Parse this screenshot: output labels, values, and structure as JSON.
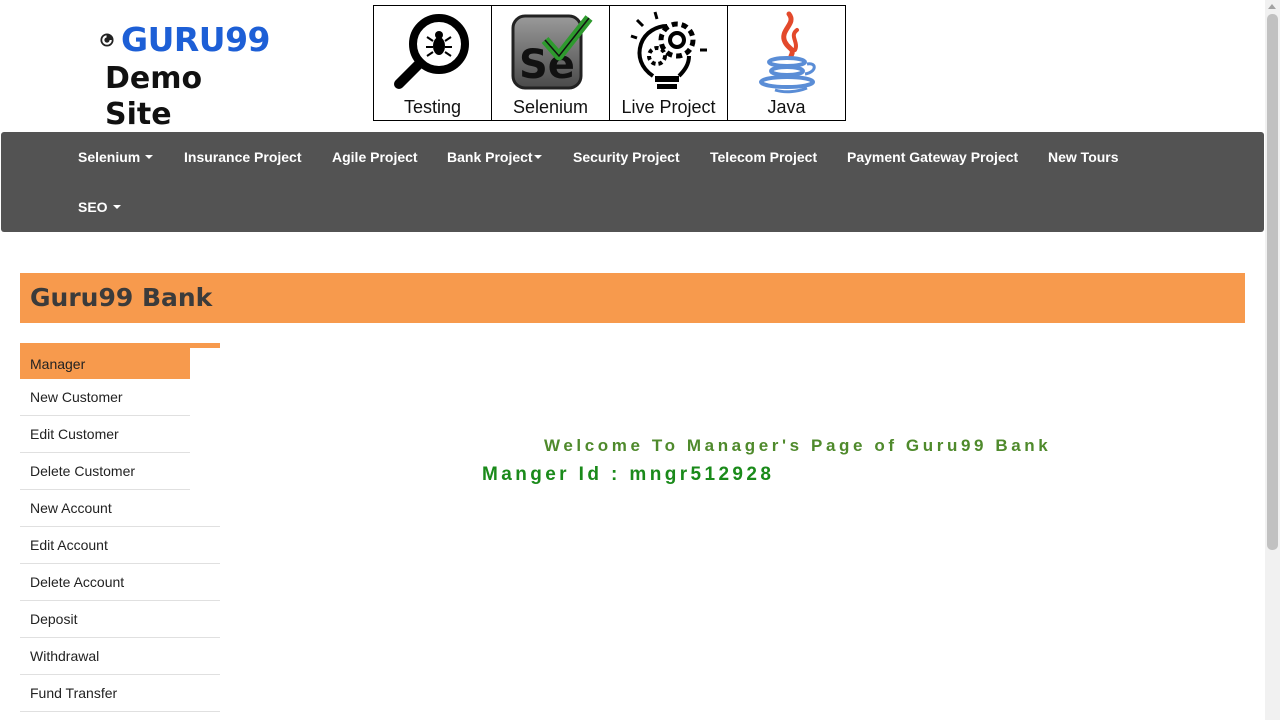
{
  "header": {
    "logo_text": "GURU99",
    "logo_sub": "Demo Site",
    "tiles": [
      {
        "label": "Testing",
        "icon": "magnifier-bug-icon"
      },
      {
        "label": "Selenium",
        "icon": "selenium-icon"
      },
      {
        "label": "Live Project",
        "icon": "lightbulb-gear-icon"
      },
      {
        "label": "Java",
        "icon": "java-icon"
      }
    ]
  },
  "navbar": {
    "items": [
      {
        "label": "Selenium",
        "dropdown": true
      },
      {
        "label": "Insurance Project",
        "dropdown": false
      },
      {
        "label": "Agile Project",
        "dropdown": false
      },
      {
        "label": "Bank Project",
        "dropdown": true
      },
      {
        "label": "Security Project",
        "dropdown": false
      },
      {
        "label": "Telecom Project",
        "dropdown": false
      },
      {
        "label": "Payment Gateway Project",
        "dropdown": false
      },
      {
        "label": "New Tours",
        "dropdown": false
      },
      {
        "label": "SEO",
        "dropdown": true
      }
    ]
  },
  "banner": {
    "title": "Guru99 Bank"
  },
  "sidebar": {
    "items": [
      {
        "label": "Manager",
        "active": true
      },
      {
        "label": "New Customer"
      },
      {
        "label": "Edit Customer"
      },
      {
        "label": "Delete Customer"
      },
      {
        "label": "New Account"
      },
      {
        "label": "Edit Account"
      },
      {
        "label": "Delete Account"
      },
      {
        "label": "Deposit"
      },
      {
        "label": "Withdrawal"
      },
      {
        "label": "Fund Transfer"
      }
    ]
  },
  "main": {
    "welcome": "Welcome To Manager's Page of Guru99 Bank",
    "manager_id": "Manger Id : mngr512928"
  },
  "colors": {
    "accent_orange": "#f79a4d",
    "navbar_bg": "#535353",
    "logo_blue": "#1d5fd6",
    "welcome_green": "#4f8a2c",
    "manager_id_green": "#1a8a1a"
  }
}
